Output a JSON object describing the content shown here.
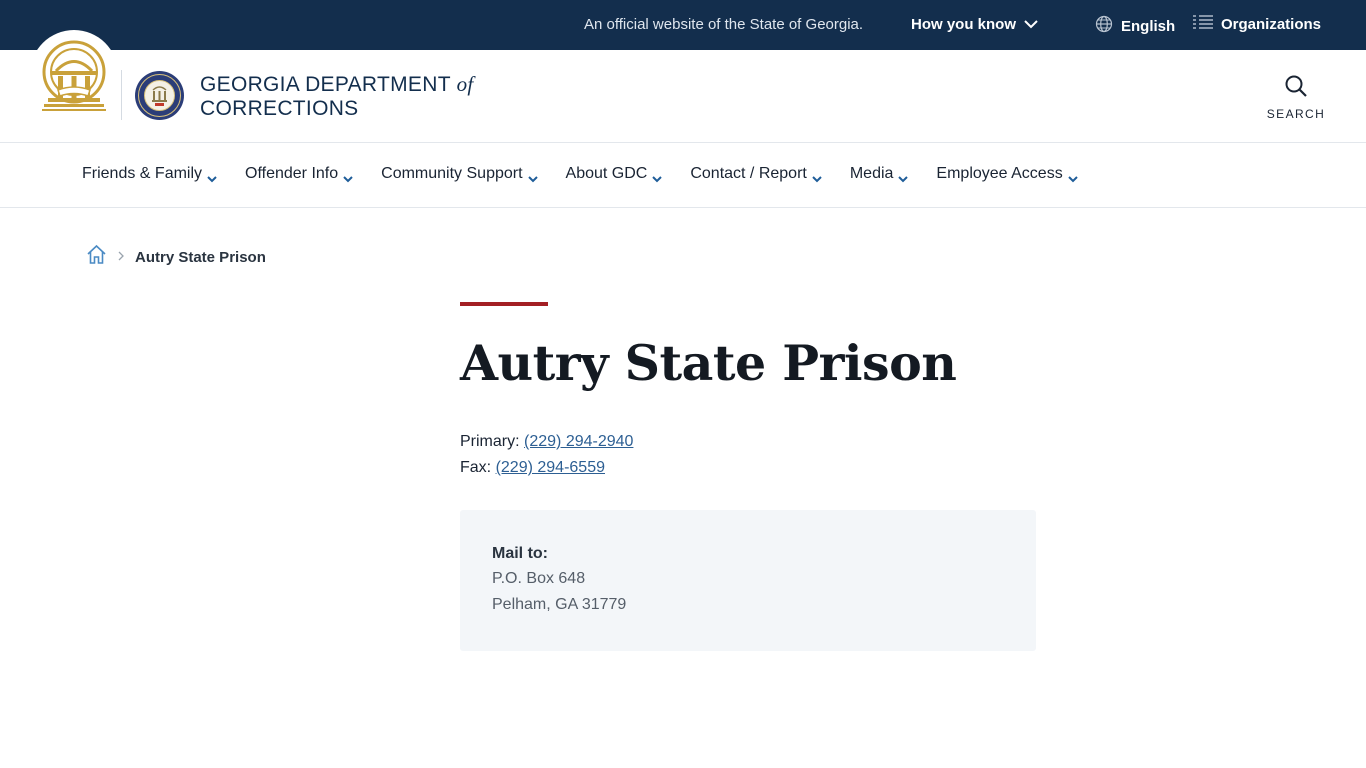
{
  "topbar": {
    "official_text": "An official website of the State of Georgia.",
    "how_you_know": "How you know",
    "language": "English",
    "organizations": "Organizations"
  },
  "header": {
    "agency_name_line1": "GEORGIA DEPARTMENT",
    "agency_name_of": "of",
    "agency_name_line2": "CORRECTIONS",
    "search_label": "SEARCH"
  },
  "nav": {
    "items": [
      {
        "label": "Friends & Family"
      },
      {
        "label": "Offender Info"
      },
      {
        "label": "Community Support"
      },
      {
        "label": "About GDC"
      },
      {
        "label": "Contact / Report"
      },
      {
        "label": "Media"
      },
      {
        "label": "Employee Access"
      }
    ]
  },
  "breadcrumb": {
    "current": "Autry State Prison"
  },
  "main": {
    "title": "Autry State Prison",
    "primary_label": "Primary:",
    "primary_phone": "(229) 294-2940",
    "fax_label": "Fax:",
    "fax_phone": "(229) 294-6559",
    "mail_label": "Mail to:",
    "mail_line1": "P.O. Box 648",
    "mail_line2": "Pelham, GA 31779"
  },
  "colors": {
    "topbar_bg": "#132e4d",
    "accent_rule": "#a31f24",
    "link": "#2d5f93",
    "seal_gold": "#c9a13a",
    "dept_seal_navy": "#2b3d78"
  }
}
